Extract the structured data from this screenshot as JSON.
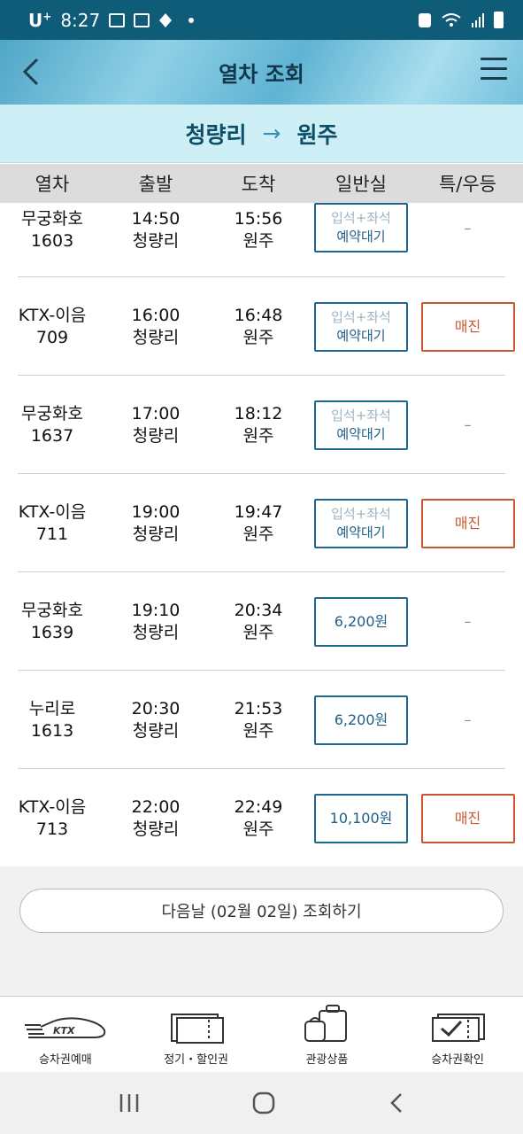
{
  "status_bar": {
    "carrier": "U",
    "carrier_sup": "+",
    "time": "8:27"
  },
  "header": {
    "title": "열차 조회"
  },
  "route": {
    "from": "청량리",
    "arrow": "→",
    "to": "원주"
  },
  "columns": [
    "열차",
    "출발",
    "도착",
    "일반실",
    "특/우등"
  ],
  "trains": [
    {
      "name": "무궁화호",
      "number": "1603",
      "dep_time": "14:50",
      "dep_station": "청량리",
      "arr_time": "15:56",
      "arr_station": "원주",
      "general": {
        "type": "wait",
        "top": "입석+좌석",
        "bottom": "예약대기"
      },
      "special": {
        "type": "dash",
        "text": "–"
      }
    },
    {
      "name": "KTX-이음",
      "number": "709",
      "dep_time": "16:00",
      "dep_station": "청량리",
      "arr_time": "16:48",
      "arr_station": "원주",
      "general": {
        "type": "wait",
        "top": "입석+좌석",
        "bottom": "예약대기"
      },
      "special": {
        "type": "sold",
        "text": "매진"
      }
    },
    {
      "name": "무궁화호",
      "number": "1637",
      "dep_time": "17:00",
      "dep_station": "청량리",
      "arr_time": "18:12",
      "arr_station": "원주",
      "general": {
        "type": "wait",
        "top": "입석+좌석",
        "bottom": "예약대기"
      },
      "special": {
        "type": "dash",
        "text": "–"
      }
    },
    {
      "name": "KTX-이음",
      "number": "711",
      "dep_time": "19:00",
      "dep_station": "청량리",
      "arr_time": "19:47",
      "arr_station": "원주",
      "general": {
        "type": "wait",
        "top": "입석+좌석",
        "bottom": "예약대기"
      },
      "special": {
        "type": "sold",
        "text": "매진"
      }
    },
    {
      "name": "무궁화호",
      "number": "1639",
      "dep_time": "19:10",
      "dep_station": "청량리",
      "arr_time": "20:34",
      "arr_station": "원주",
      "general": {
        "type": "price",
        "text": "6,200원"
      },
      "special": {
        "type": "dash",
        "text": "–"
      }
    },
    {
      "name": "누리로",
      "number": "1613",
      "dep_time": "20:30",
      "dep_station": "청량리",
      "arr_time": "21:53",
      "arr_station": "원주",
      "general": {
        "type": "price",
        "text": "6,200원"
      },
      "special": {
        "type": "dash",
        "text": "–"
      }
    },
    {
      "name": "KTX-이음",
      "number": "713",
      "dep_time": "22:00",
      "dep_station": "청량리",
      "arr_time": "22:49",
      "arr_station": "원주",
      "general": {
        "type": "price",
        "text": "10,100원"
      },
      "special": {
        "type": "sold",
        "text": "매진"
      }
    }
  ],
  "next_day_button": "다음날 (02월 02일) 조회하기",
  "tabs": [
    {
      "label": "승차권예매",
      "icon": "ktx-train-icon",
      "logo_text": "KTX"
    },
    {
      "label": "정기・할인권",
      "icon": "ticket-icon"
    },
    {
      "label": "관광상품",
      "icon": "luggage-icon"
    },
    {
      "label": "승차권확인",
      "icon": "ticket-check-icon"
    }
  ],
  "colors": {
    "status_bar": "#0f5c78",
    "route_bar": "#cfeff7",
    "seat_border": "#1f6a92",
    "sold_border": "#c9562f"
  }
}
